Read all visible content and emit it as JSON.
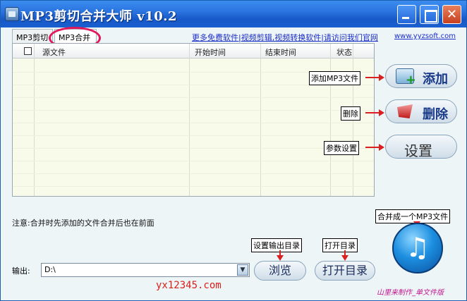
{
  "window": {
    "title": "MP3剪切合并大师 v10.2",
    "close_glyph": "✕"
  },
  "tabs": {
    "cut": "MP3剪切",
    "merge": "MP3合并"
  },
  "promo": {
    "link": "更多免费软件|视频剪辑,视频转换软件|请访问我们官网",
    "url": "www.yyzsoft.com"
  },
  "table": {
    "headers": {
      "source": "源文件",
      "start": "开始时间",
      "end": "结束时间",
      "status": "状态"
    }
  },
  "side_buttons": {
    "add": "添加",
    "delete": "删除",
    "settings": "设置"
  },
  "callouts": {
    "add": "添加MP3文件",
    "delete": "删除",
    "settings": "参数设置",
    "output_dir": "设置输出目录",
    "open_dir": "打开目录",
    "merge": "合并成一个MP3文件"
  },
  "note": "注意:合并时先添加的文件合并后也在前面",
  "output": {
    "label": "输出:",
    "value": "D:\\"
  },
  "buttons": {
    "browse": "浏览",
    "open_dir": "打开目录",
    "merge_icon": "♫"
  },
  "watermark": "yx12345.com",
  "credit": "山里来制作_单文件版",
  "colors": {
    "title_bar": "#1758c7",
    "callout_arrow": "#d82020",
    "highlight": "#e0185a"
  }
}
